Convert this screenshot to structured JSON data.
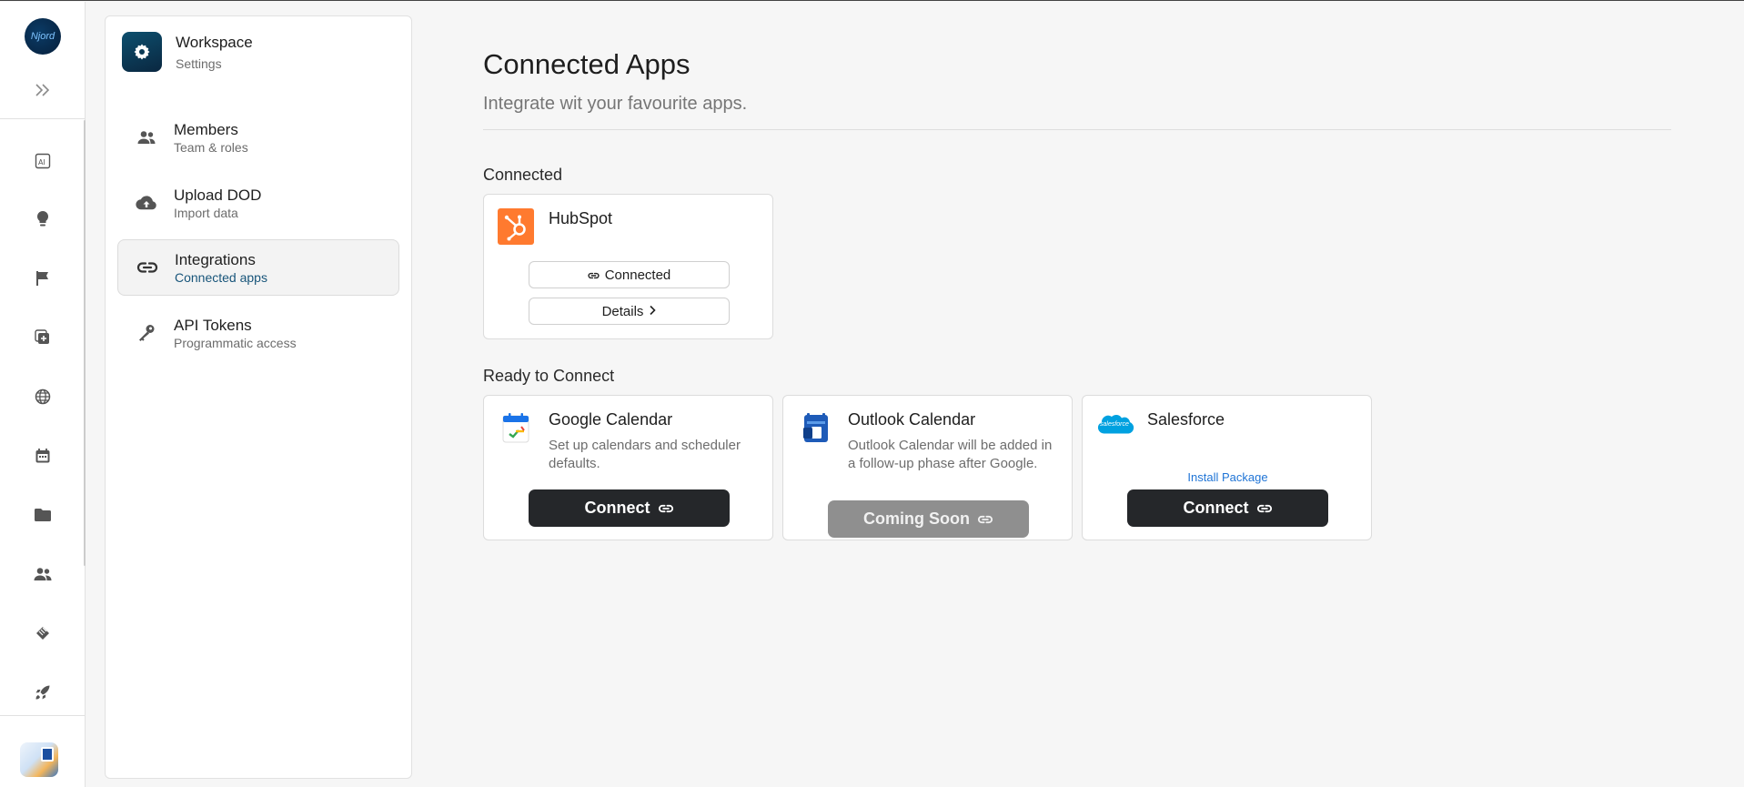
{
  "rail": {
    "logo_text": "Njord",
    "icons": [
      "ai-icon",
      "lightbulb-icon",
      "flag-icon",
      "add-document-icon",
      "globe-icon",
      "calendar-icon",
      "folder-icon",
      "people-icon",
      "handshake-icon",
      "rocket-icon"
    ]
  },
  "settings_panel": {
    "workspace": {
      "title": "Workspace",
      "subtitle": "Settings"
    },
    "items": [
      {
        "title": "Members",
        "subtitle": "Team & roles",
        "icon": "people-icon"
      },
      {
        "title": "Upload DOD",
        "subtitle": "Import data",
        "icon": "cloud-upload-icon"
      },
      {
        "title": "Integrations",
        "subtitle": "Connected apps",
        "icon": "link-icon",
        "active": true
      },
      {
        "title": "API Tokens",
        "subtitle": "Programmatic access",
        "icon": "key-icon"
      }
    ]
  },
  "main": {
    "title": "Connected Apps",
    "subtitle": "Integrate wit your favourite apps.",
    "connected_label": "Connected",
    "ready_label": "Ready to Connect",
    "connected_apps": [
      {
        "name": "HubSpot",
        "status_button": "Connected",
        "details_button": "Details",
        "brand_color": "#ff7a2f"
      }
    ],
    "ready_apps": [
      {
        "name": "Google Calendar",
        "description": "Set up calendars and scheduler defaults.",
        "button": "Connect"
      },
      {
        "name": "Outlook Calendar",
        "description": "Outlook Calendar will be added in a follow-up phase after Google.",
        "button": "Coming Soon",
        "disabled": true
      },
      {
        "name": "Salesforce",
        "logo_text": "salesforce",
        "link": "Install Package",
        "button": "Connect"
      }
    ]
  }
}
